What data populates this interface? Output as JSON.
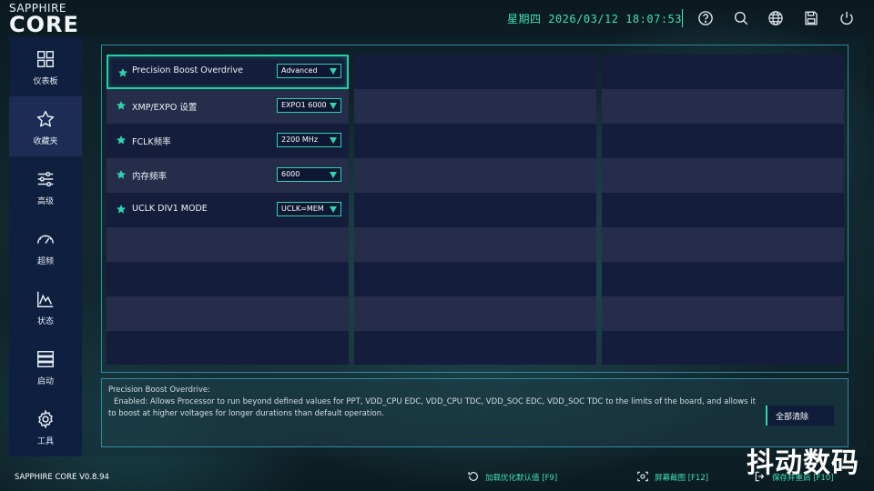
{
  "brand": {
    "small": "SAPPHIRE",
    "big": "CORE"
  },
  "header": {
    "datetime": "星期四 2026/03/12 18:07:53",
    "icons": [
      "help-icon",
      "search-icon",
      "globe-icon",
      "save-icon",
      "power-icon"
    ]
  },
  "sidebar": {
    "items": [
      {
        "label": "仪表板",
        "icon": "dashboard-icon",
        "active": false
      },
      {
        "label": "收藏夹",
        "icon": "star-icon",
        "active": true
      },
      {
        "label": "高级",
        "icon": "sliders-icon",
        "active": false
      },
      {
        "label": "超频",
        "icon": "gauge-icon",
        "active": false
      },
      {
        "label": "状态",
        "icon": "chart-icon",
        "active": false
      },
      {
        "label": "启动",
        "icon": "boot-icon",
        "active": false
      },
      {
        "label": "工具",
        "icon": "gear-icon",
        "active": false
      }
    ]
  },
  "favorites": {
    "settings": [
      {
        "name": "Precision Boost Overdrive",
        "value": "Advanced",
        "focused": true
      },
      {
        "name": "XMP/EXPO 设置",
        "value": "EXPO1 6000",
        "focused": false
      },
      {
        "name": "FCLK频率",
        "value": "2200 MHz",
        "focused": false
      },
      {
        "name": "内存频率",
        "value": "6000",
        "focused": false
      },
      {
        "name": "UCLK DIV1 MODE",
        "value": "UCLK=MEM",
        "focused": false
      }
    ]
  },
  "description": {
    "title": "Precision Boost Overdrive:",
    "text": "Enabled: Allows Processor to run beyond defined values for PPT, VDD_CPU EDC, VDD_CPU TDC, VDD_SOC EDC, VDD_SOC TDC to the limits of the board, and allows it to boost at higher voltages for longer durations than default operation.",
    "clear_label": "全部清除"
  },
  "footer": {
    "version": "SAPPHIRE CORE V0.8.94",
    "load_defaults": "加载优化默认值 [F9]",
    "screenshot": "屏幕截图 [F12]",
    "save_restart": "保存并重启 [F10]"
  },
  "watermark": "抖动数码",
  "colors": {
    "accent": "#3fe0b8",
    "panel": "#0f1f40",
    "cell_dark": "#141d3b",
    "cell_light": "#252d4a"
  }
}
